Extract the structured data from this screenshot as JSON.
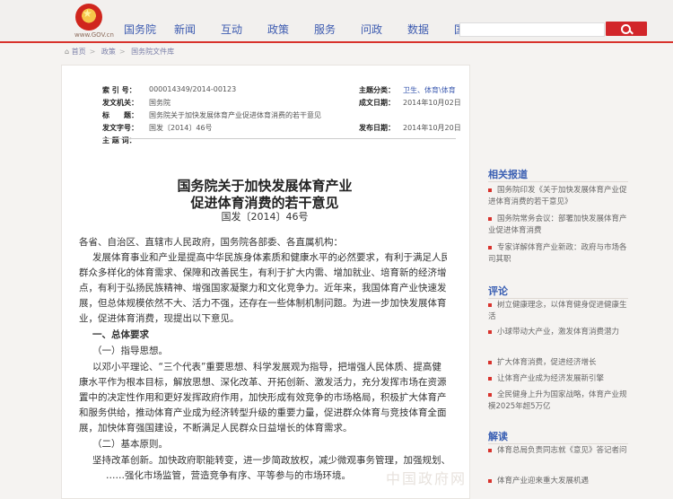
{
  "site": {
    "url": "www.GOV.cn"
  },
  "nav": [
    "国务院",
    "新闻",
    "互动",
    "政策",
    "服务",
    "问政",
    "数据",
    "国情"
  ],
  "breadcrumb": [
    "首页",
    "政策",
    "国务院文件库"
  ],
  "meta": {
    "index_label": "索 引 号：",
    "index_value": "000014349/2014-00123",
    "topic_label": "主题分类：",
    "topic_value": "卫生、体育\\体育",
    "issuer_label": "发文机关：",
    "issuer_value": "国务院",
    "date_label": "成文日期：",
    "date_value": "2014年10月02日",
    "title_label": "标　　题：",
    "title_value": "国务院关于加快发展体育产业促进体育消费的若干意见",
    "number_label": "发文字号：",
    "number_value": "国发〔2014〕46号",
    "publish_label": "发布日期：",
    "publish_value": "2014年10月20日",
    "subject_label": "主 题 词："
  },
  "doc": {
    "title1": "国务院关于加快发展体育产业",
    "title2": "促进体育消费的若干意见",
    "number": "国发〔2014〕46号",
    "paras": [
      "各省、自治区、直辖市人民政府，国务院各部委、各直属机构：",
      "发展体育事业和产业是提高中华民族身体素质和健康水平的必然要求，有利于满足人民",
      "群众多样化的体育需求、保障和改善民生，有利于扩大内需、增加就业、培育新的经济增长",
      "点，有利于弘扬民族精神、增强国家凝聚力和文化竞争力。近年来，我国体育产业快速发",
      "展，但总体规模依然不大、活力不强，还存在一些体制机制问题。为进一步加快发展体育产",
      "业，促进体育消费，现提出以下意见。",
      "一、总体要求",
      "（一）指导思想。",
      "以邓小平理论、“三个代表”重要思想、科学发展观为指导，把增强人民体质、提高健",
      "康水平作为根本目标，解放思想、深化改革、开拓创新、激发活力，充分发挥市场在资源配",
      "置中的决定性作用和更好发挥政府作用，加快形成有效竞争的市场格局，积极扩大体育产品",
      "和服务供给，推动体育产业成为经济转型升级的重要力量，促进群众体育与竞技体育全面发",
      "展，加快体育强国建设，不断满足人民群众日益增长的体育需求。",
      "（二）基本原则。",
      "坚持改革创新。加快政府职能转变，进一步简政放权，减少微观事务管理，加强规划、",
      "……强化市场监管，营造竞争有序、平等参与的市场环境。"
    ]
  },
  "sidebar": {
    "related_title": "相关报道",
    "related": [
      "国务院印发《关于加快发展体育产业促进体育消费的若干意见》",
      "国务院常务会议：部署加快发展体育产业促进体育消费",
      "专家详解体育产业新政：政府与市场各司其职"
    ],
    "comment_title": "评论",
    "comments": [
      "树立健康理念，以体育健身促进健康生活",
      "小球带动大产业，激发体育消费潜力",
      "扩大体育消费，促进经济增长",
      "让体育产业成为经济发展新引擎",
      "全民健身上升为国家战略，体育产业规模2025年超5万亿"
    ],
    "explain_title": "解读",
    "explains": [
      "体育总局负责同志就《意见》答记者问",
      "体育产业迎来重大发展机遇"
    ]
  },
  "watermark": "中国政府网"
}
